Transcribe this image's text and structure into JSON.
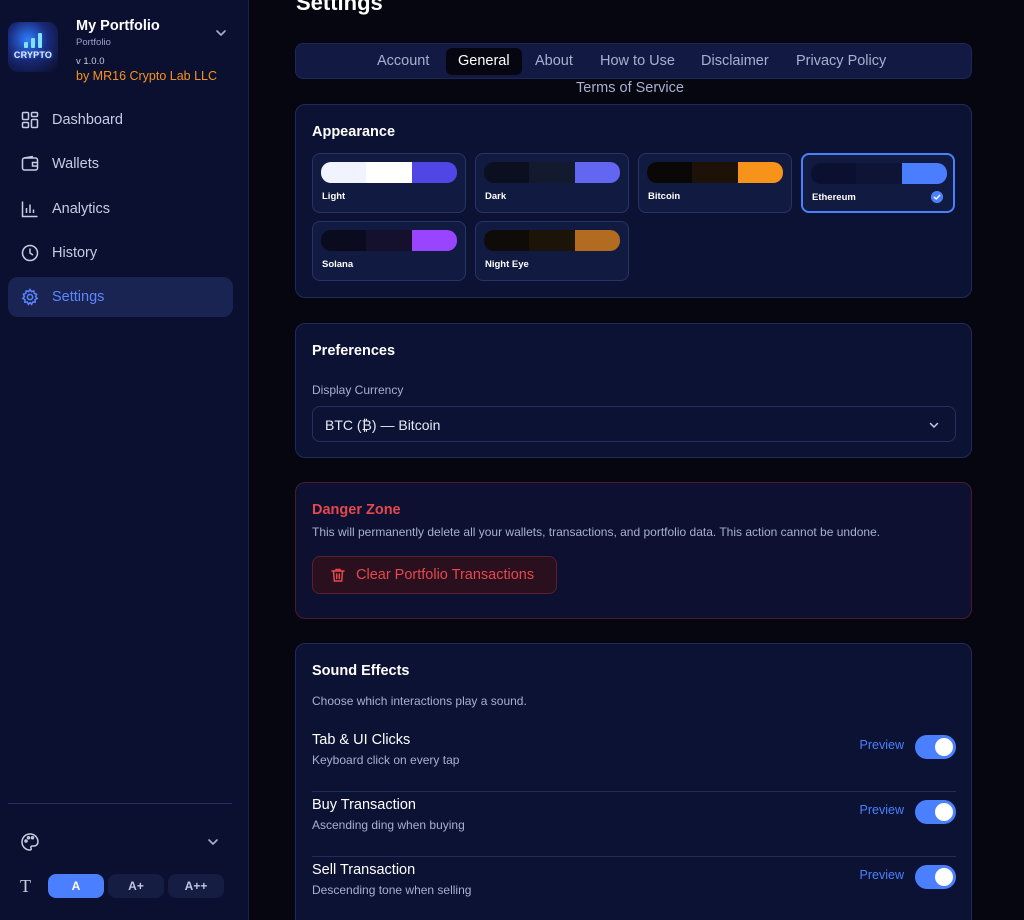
{
  "sidebar": {
    "brand": {
      "logo_text": "CRYPTO",
      "title": "My Portfolio",
      "subtitle": "Portfolio",
      "version": "v 1.0.0",
      "by": "by MR16 Crypto Lab LLC"
    },
    "nav": [
      {
        "label": "Dashboard",
        "icon": "dashboard-icon"
      },
      {
        "label": "Wallets",
        "icon": "wallet-icon"
      },
      {
        "label": "Analytics",
        "icon": "analytics-icon"
      },
      {
        "label": "History",
        "icon": "clock-icon"
      },
      {
        "label": "Settings",
        "icon": "gear-icon",
        "active": true
      }
    ],
    "font_sizes": [
      "A",
      "A+",
      "A++"
    ],
    "font_size_selected": "A"
  },
  "page": {
    "title": "Settings",
    "tabs": [
      "Account",
      "General",
      "About",
      "How to Use",
      "Disclaimer",
      "Privacy Policy",
      "Terms of Service"
    ],
    "active_tab": "General"
  },
  "appearance": {
    "title": "Appearance",
    "themes": [
      {
        "name": "Light",
        "colors": [
          "#f1f4ff",
          "#ffffff",
          "#4f46e5"
        ]
      },
      {
        "name": "Dark",
        "colors": [
          "#0b0f1f",
          "#131a2e",
          "#6366f1"
        ]
      },
      {
        "name": "Bitcoin",
        "colors": [
          "#0a0806",
          "#1d1208",
          "#f7931a"
        ]
      },
      {
        "name": "Ethereum",
        "colors": [
          "#0b1030",
          "#0e1436",
          "#4a7dff"
        ],
        "selected": true
      },
      {
        "name": "Solana",
        "colors": [
          "#0a0b1f",
          "#14102e",
          "#9945ff"
        ]
      },
      {
        "name": "Night Eye",
        "colors": [
          "#0e0b08",
          "#1c1408",
          "#b36b22"
        ]
      }
    ]
  },
  "preferences": {
    "title": "Preferences",
    "currency_label": "Display Currency",
    "currency_value": "BTC (₿) — Bitcoin"
  },
  "danger_zone": {
    "title": "Danger Zone",
    "text": "This will permanently delete all your wallets, transactions, and portfolio data. This action cannot be undone.",
    "button": "Clear Portfolio Transactions"
  },
  "sound": {
    "title": "Sound Effects",
    "description": "Choose which interactions play a sound.",
    "preview_label": "Preview",
    "items": [
      {
        "name": "Tab & UI Clicks",
        "desc": "Keyboard click on every tap",
        "enabled": true
      },
      {
        "name": "Buy Transaction",
        "desc": "Ascending ding when buying",
        "enabled": true
      },
      {
        "name": "Sell Transaction",
        "desc": "Descending tone when selling",
        "enabled": true
      }
    ]
  },
  "colors": {
    "accent": "#4a80ff",
    "danger": "#e5484d",
    "brand_orange": "#f7931a"
  }
}
